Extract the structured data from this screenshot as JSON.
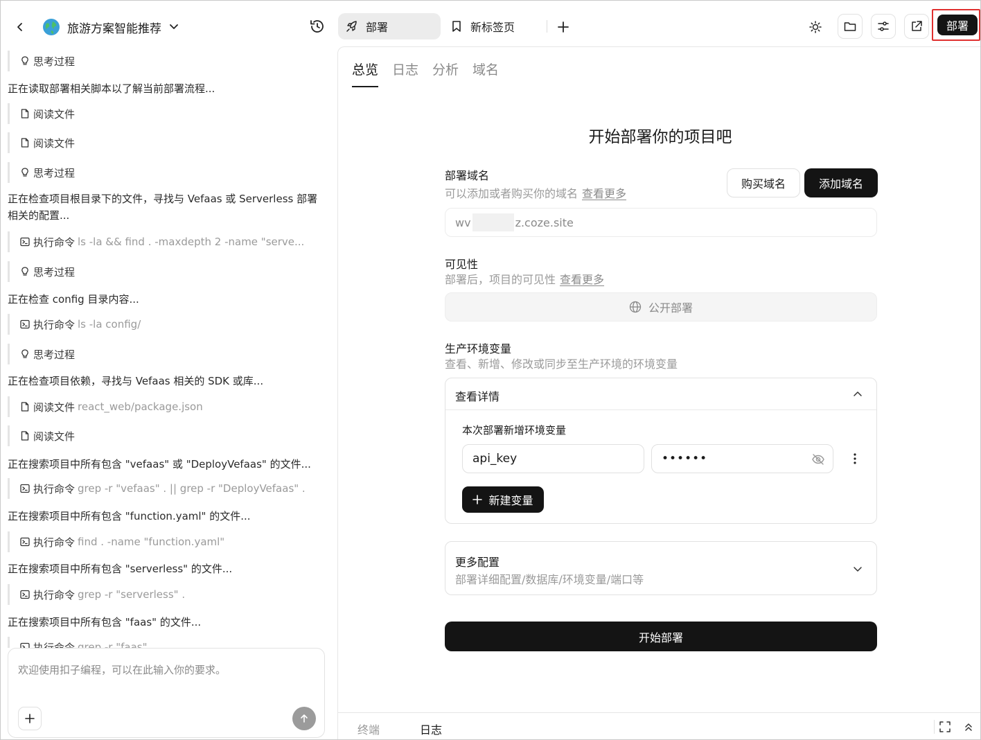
{
  "header": {
    "app_title": "旅游方案智能推荐",
    "tabs": [
      {
        "label": "部署",
        "icon": "rocket-icon"
      },
      {
        "label": "新标签页",
        "icon": "bookmark-icon"
      }
    ],
    "deploy_button": "部署"
  },
  "left_panel": {
    "entries": [
      {
        "kind": "step",
        "icon": "lightbulb-icon",
        "label": "思考过程",
        "detail": ""
      },
      {
        "kind": "text",
        "text": "正在读取部署相关脚本以了解当前部署流程..."
      },
      {
        "kind": "step",
        "icon": "file-icon",
        "label": "阅读文件",
        "detail": ""
      },
      {
        "kind": "step",
        "icon": "file-icon",
        "label": "阅读文件",
        "detail": ""
      },
      {
        "kind": "step",
        "icon": "lightbulb-icon",
        "label": "思考过程",
        "detail": ""
      },
      {
        "kind": "text",
        "text": "正在检查项目根目录下的文件，寻找与 Vefaas 或 Serverless 部署相关的配置..."
      },
      {
        "kind": "step",
        "icon": "terminal-icon",
        "label": "执行命令",
        "detail": "ls -la && find . -maxdepth 2 -name \"serve..."
      },
      {
        "kind": "step",
        "icon": "lightbulb-icon",
        "label": "思考过程",
        "detail": ""
      },
      {
        "kind": "text",
        "text": "正在检查 config 目录内容..."
      },
      {
        "kind": "step",
        "icon": "terminal-icon",
        "label": "执行命令",
        "detail": "ls -la config/"
      },
      {
        "kind": "step",
        "icon": "lightbulb-icon",
        "label": "思考过程",
        "detail": ""
      },
      {
        "kind": "text",
        "text": "正在检查项目依赖，寻找与 Vefaas 相关的 SDK 或库..."
      },
      {
        "kind": "step",
        "icon": "file-icon",
        "label": "阅读文件",
        "detail": "react_web/package.json"
      },
      {
        "kind": "step",
        "icon": "file-icon",
        "label": "阅读文件",
        "detail": ""
      },
      {
        "kind": "text",
        "text": "正在搜索项目中所有包含 \"vefaas\" 或 \"DeployVefaas\" 的文件..."
      },
      {
        "kind": "step",
        "icon": "terminal-icon",
        "label": "执行命令",
        "detail": "grep -r \"vefaas\" . || grep -r \"DeployVefaas\" ."
      },
      {
        "kind": "text",
        "text": "正在搜索项目中所有包含 \"function.yaml\" 的文件..."
      },
      {
        "kind": "step",
        "icon": "terminal-icon",
        "label": "执行命令",
        "detail": "find . -name \"function.yaml\""
      },
      {
        "kind": "text",
        "text": "正在搜索项目中所有包含 \"serverless\" 的文件..."
      },
      {
        "kind": "step",
        "icon": "terminal-icon",
        "label": "执行命令",
        "detail": "grep -r \"serverless\" ."
      },
      {
        "kind": "text",
        "text": "正在搜索项目中所有包含 \"faas\" 的文件..."
      },
      {
        "kind": "step",
        "icon": "terminal-icon",
        "label": "执行命令",
        "detail": "grep -r \"faas\""
      }
    ],
    "chat_placeholder": "欢迎使用扣子编程，可以在此输入你的要求。"
  },
  "right_panel": {
    "subtabs": [
      "总览",
      "日志",
      "分析",
      "域名"
    ],
    "active_subtab": "总览",
    "title": "开始部署你的项目吧",
    "domain": {
      "label": "部署域名",
      "desc": "可以添加或者购买你的域名",
      "more_link": "查看更多",
      "buy_button": "购买域名",
      "add_button": "添加域名",
      "value_prefix": "wv",
      "value_suffix": "z.coze.site"
    },
    "visibility": {
      "label": "可见性",
      "desc": "部署后，项目的可见性",
      "more_link": "查看更多",
      "value": "公开部署"
    },
    "env": {
      "label": "生产环境变量",
      "desc": "查看、新增、修改或同步至生产环境的环境变量",
      "card_title": "查看详情",
      "sub_label": "本次部署新增环境变量",
      "key": "api_key",
      "value_masked": "••••••",
      "add_button": "新建变量"
    },
    "more_config": {
      "title": "更多配置",
      "desc": "部署详细配置/数据库/环境变量/端口等"
    },
    "start_button": "开始部署",
    "bottom_tabs": [
      "终端",
      "日志"
    ]
  }
}
